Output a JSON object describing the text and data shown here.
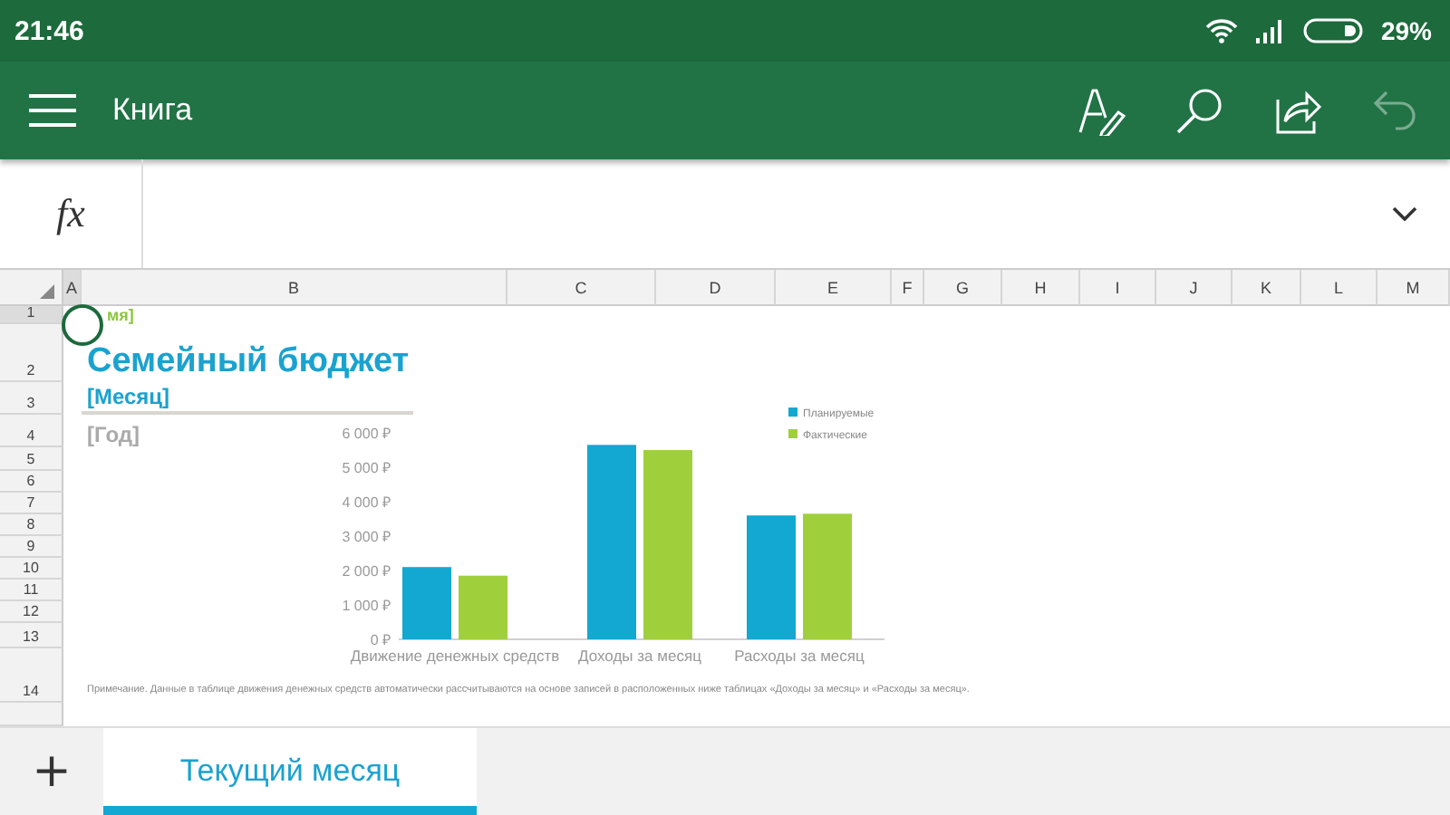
{
  "status_bar": {
    "time": "21:46",
    "battery": "29%"
  },
  "toolbar": {
    "title": "Книга",
    "undo": {
      "disabled": true
    }
  },
  "formula_bar": {
    "function_label": "fx"
  },
  "columns": [
    {
      "label": "A",
      "selected": true
    },
    {
      "label": "B",
      "selected": false
    },
    {
      "label": "C",
      "selected": false
    },
    {
      "label": "D",
      "selected": false
    },
    {
      "label": "E",
      "selected": false
    },
    {
      "label": "F",
      "selected": false
    },
    {
      "label": "G",
      "selected": false
    },
    {
      "label": "H",
      "selected": false
    },
    {
      "label": "I",
      "selected": false
    },
    {
      "label": "J",
      "selected": false
    },
    {
      "label": "K",
      "selected": false
    },
    {
      "label": "L",
      "selected": false
    },
    {
      "label": "M",
      "selected": false
    }
  ],
  "rows": [
    {
      "label": "1",
      "selected": true
    },
    {
      "label": "2",
      "selected": false
    },
    {
      "label": "3",
      "selected": false
    },
    {
      "label": "4",
      "selected": false
    },
    {
      "label": "5",
      "selected": false
    },
    {
      "label": "6",
      "selected": false
    },
    {
      "label": "7",
      "selected": false
    },
    {
      "label": "8",
      "selected": false
    },
    {
      "label": "9",
      "selected": false
    },
    {
      "label": "10",
      "selected": false
    },
    {
      "label": "11",
      "selected": false
    },
    {
      "label": "12",
      "selected": false
    },
    {
      "label": "13",
      "selected": false
    },
    {
      "label": "14",
      "selected": false
    }
  ],
  "sheet": {
    "cell_text": "мя]",
    "title": "Семейный бюджет",
    "month": "[Месяц]",
    "year": "[Год]",
    "note": "Примечание. Данные в таблице движения денежных средств автоматически рассчитываются на основе записей в расположенных ниже таблицах «Доходы за месяц» и «Расходы за месяц».",
    "chart_data": {
      "type": "bar",
      "categories": [
        "Движение денежных средств",
        "Доходы за месяц",
        "Расходы за месяц"
      ],
      "series": [
        {
          "name": "Планируемые",
          "color": "#12a8d2",
          "values": [
            2100,
            5650,
            3600
          ]
        },
        {
          "name": "Фактические",
          "color": "#9fd03c",
          "values": [
            1850,
            5500,
            3650
          ]
        }
      ],
      "ylim": [
        0,
        6000
      ],
      "legend": "top-right",
      "yticks": [
        {
          "value": 0,
          "label": "0 ₽"
        },
        {
          "value": 1000,
          "label": "1 000 ₽"
        },
        {
          "value": 2000,
          "label": "2 000 ₽"
        },
        {
          "value": 3000,
          "label": "3 000 ₽"
        },
        {
          "value": 4000,
          "label": "4 000 ₽"
        },
        {
          "value": 5000,
          "label": "5 000 ₽"
        },
        {
          "value": 6000,
          "label": "6 000 ₽"
        }
      ]
    }
  },
  "tabs": [
    {
      "label": "Текущий месяц",
      "selected": true
    }
  ],
  "add_tab": "+"
}
